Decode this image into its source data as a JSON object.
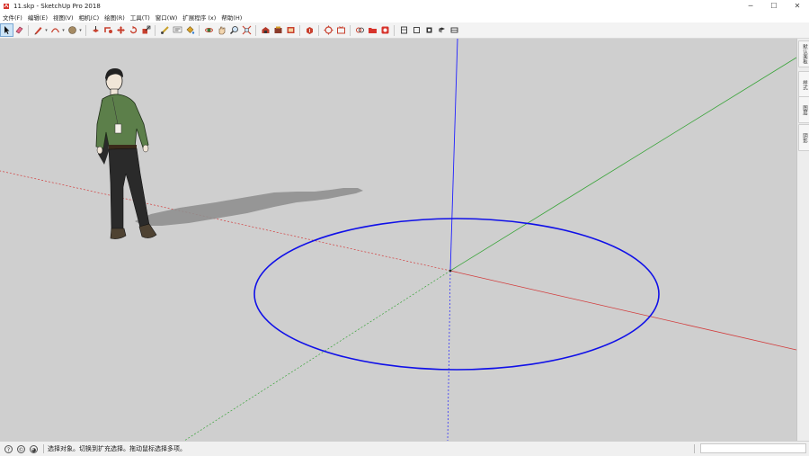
{
  "window": {
    "title": "11.skp - SketchUp Pro 2018",
    "minimize_glyph": "─",
    "maximize_glyph": "☐",
    "close_glyph": "✕"
  },
  "menu": {
    "items": [
      {
        "label": "文件(F)"
      },
      {
        "label": "编辑(E)"
      },
      {
        "label": "视图(V)"
      },
      {
        "label": "相机(C)"
      },
      {
        "label": "绘图(R)"
      },
      {
        "label": "工具(T)"
      },
      {
        "label": "窗口(W)"
      },
      {
        "label": "扩展程序 (x)"
      },
      {
        "label": "帮助(H)"
      }
    ]
  },
  "toolbar": {
    "tools": [
      {
        "name": "select-tool",
        "icon": "arrow-cursor-icon",
        "active": true
      },
      {
        "name": "eraser-tool",
        "icon": "eraser-icon"
      },
      {
        "name": "line-tool",
        "icon": "pencil-icon"
      },
      {
        "name": "arc-tool",
        "icon": "arc-icon"
      },
      {
        "name": "shape-tool",
        "icon": "shape-icon"
      },
      {
        "name": "pushpull-tool",
        "icon": "pushpull-icon"
      },
      {
        "name": "followme-tool",
        "icon": "followme-icon"
      },
      {
        "name": "move-tool",
        "icon": "move-icon"
      },
      {
        "name": "rotate-tool",
        "icon": "rotate-icon"
      },
      {
        "name": "scale-tool",
        "icon": "scale-icon"
      },
      {
        "name": "tape-measure-tool",
        "icon": "tape-measure-icon"
      },
      {
        "name": "text-tool",
        "icon": "text-icon"
      },
      {
        "name": "paint-bucket-tool",
        "icon": "paint-bucket-icon"
      },
      {
        "name": "orbit-tool",
        "icon": "orbit-icon"
      },
      {
        "name": "pan-tool",
        "icon": "pan-icon"
      },
      {
        "name": "zoom-tool",
        "icon": "zoom-icon"
      },
      {
        "name": "zoom-extents-tool",
        "icon": "zoom-extents-icon"
      },
      {
        "name": "warehouse-tool",
        "icon": "warehouse-icon"
      },
      {
        "name": "extension-warehouse-tool",
        "icon": "extension-warehouse-icon"
      },
      {
        "name": "layout-tool",
        "icon": "layout-icon"
      },
      {
        "name": "extension-manager-tool",
        "icon": "extension-manager-icon"
      },
      {
        "name": "styles-tool",
        "icon": "styles-icon"
      },
      {
        "name": "scenes-tool",
        "icon": "scenes-icon"
      },
      {
        "name": "section-tool",
        "icon": "section-icon"
      },
      {
        "name": "red-folder-tool",
        "icon": "folder-icon"
      },
      {
        "name": "red-app-tool",
        "icon": "app-icon"
      },
      {
        "name": "view-iso-tool",
        "icon": "view-iso-icon"
      },
      {
        "name": "view-top-tool",
        "icon": "view-top-icon"
      },
      {
        "name": "view-front-tool",
        "icon": "view-front-icon"
      },
      {
        "name": "view-right-tool",
        "icon": "view-right-icon"
      },
      {
        "name": "view-back-tool",
        "icon": "view-back-icon"
      }
    ]
  },
  "tray": {
    "tabs": [
      {
        "label": "默认面板"
      },
      {
        "label": "样式"
      },
      {
        "label": "图层"
      },
      {
        "label": "阴影"
      }
    ]
  },
  "status": {
    "icons": [
      {
        "name": "geo-location-icon",
        "glyph": "?"
      },
      {
        "name": "credits-icon",
        "glyph": "©"
      },
      {
        "name": "user-icon",
        "glyph": "◕"
      }
    ],
    "message": "选择对象。切换到扩充选择。拖动鼠标选择多项。",
    "measurements_value": ""
  },
  "colors": {
    "axis_red": "#d23b3b",
    "axis_green": "#3aa43a",
    "axis_blue": "#2020ff",
    "circle": "#1010e8",
    "viewport_bg": "#cfcfcf",
    "shadow": "#8f8f8f",
    "shirt": "#5c7f4a",
    "pants": "#2a2a2a"
  }
}
